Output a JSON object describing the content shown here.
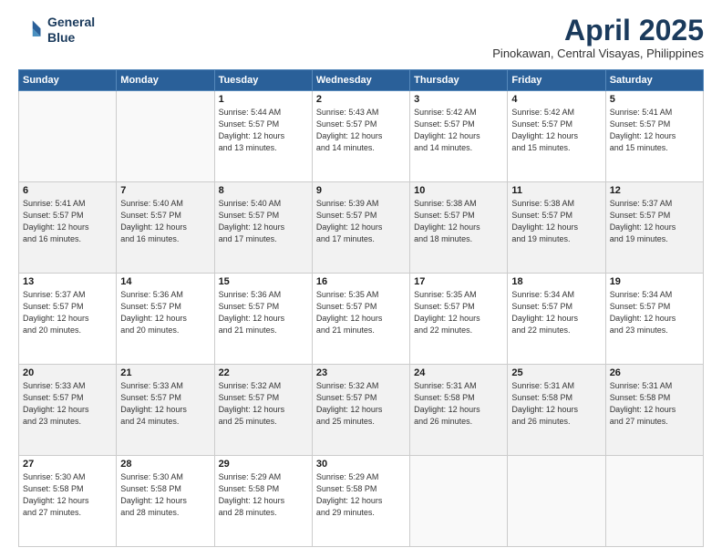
{
  "header": {
    "logo_line1": "General",
    "logo_line2": "Blue",
    "title": "April 2025",
    "subtitle": "Pinokawan, Central Visayas, Philippines"
  },
  "days_of_week": [
    "Sunday",
    "Monday",
    "Tuesday",
    "Wednesday",
    "Thursday",
    "Friday",
    "Saturday"
  ],
  "weeks": [
    [
      {
        "num": "",
        "info": ""
      },
      {
        "num": "",
        "info": ""
      },
      {
        "num": "1",
        "info": "Sunrise: 5:44 AM\nSunset: 5:57 PM\nDaylight: 12 hours\nand 13 minutes."
      },
      {
        "num": "2",
        "info": "Sunrise: 5:43 AM\nSunset: 5:57 PM\nDaylight: 12 hours\nand 14 minutes."
      },
      {
        "num": "3",
        "info": "Sunrise: 5:42 AM\nSunset: 5:57 PM\nDaylight: 12 hours\nand 14 minutes."
      },
      {
        "num": "4",
        "info": "Sunrise: 5:42 AM\nSunset: 5:57 PM\nDaylight: 12 hours\nand 15 minutes."
      },
      {
        "num": "5",
        "info": "Sunrise: 5:41 AM\nSunset: 5:57 PM\nDaylight: 12 hours\nand 15 minutes."
      }
    ],
    [
      {
        "num": "6",
        "info": "Sunrise: 5:41 AM\nSunset: 5:57 PM\nDaylight: 12 hours\nand 16 minutes."
      },
      {
        "num": "7",
        "info": "Sunrise: 5:40 AM\nSunset: 5:57 PM\nDaylight: 12 hours\nand 16 minutes."
      },
      {
        "num": "8",
        "info": "Sunrise: 5:40 AM\nSunset: 5:57 PM\nDaylight: 12 hours\nand 17 minutes."
      },
      {
        "num": "9",
        "info": "Sunrise: 5:39 AM\nSunset: 5:57 PM\nDaylight: 12 hours\nand 17 minutes."
      },
      {
        "num": "10",
        "info": "Sunrise: 5:38 AM\nSunset: 5:57 PM\nDaylight: 12 hours\nand 18 minutes."
      },
      {
        "num": "11",
        "info": "Sunrise: 5:38 AM\nSunset: 5:57 PM\nDaylight: 12 hours\nand 19 minutes."
      },
      {
        "num": "12",
        "info": "Sunrise: 5:37 AM\nSunset: 5:57 PM\nDaylight: 12 hours\nand 19 minutes."
      }
    ],
    [
      {
        "num": "13",
        "info": "Sunrise: 5:37 AM\nSunset: 5:57 PM\nDaylight: 12 hours\nand 20 minutes."
      },
      {
        "num": "14",
        "info": "Sunrise: 5:36 AM\nSunset: 5:57 PM\nDaylight: 12 hours\nand 20 minutes."
      },
      {
        "num": "15",
        "info": "Sunrise: 5:36 AM\nSunset: 5:57 PM\nDaylight: 12 hours\nand 21 minutes."
      },
      {
        "num": "16",
        "info": "Sunrise: 5:35 AM\nSunset: 5:57 PM\nDaylight: 12 hours\nand 21 minutes."
      },
      {
        "num": "17",
        "info": "Sunrise: 5:35 AM\nSunset: 5:57 PM\nDaylight: 12 hours\nand 22 minutes."
      },
      {
        "num": "18",
        "info": "Sunrise: 5:34 AM\nSunset: 5:57 PM\nDaylight: 12 hours\nand 22 minutes."
      },
      {
        "num": "19",
        "info": "Sunrise: 5:34 AM\nSunset: 5:57 PM\nDaylight: 12 hours\nand 23 minutes."
      }
    ],
    [
      {
        "num": "20",
        "info": "Sunrise: 5:33 AM\nSunset: 5:57 PM\nDaylight: 12 hours\nand 23 minutes."
      },
      {
        "num": "21",
        "info": "Sunrise: 5:33 AM\nSunset: 5:57 PM\nDaylight: 12 hours\nand 24 minutes."
      },
      {
        "num": "22",
        "info": "Sunrise: 5:32 AM\nSunset: 5:57 PM\nDaylight: 12 hours\nand 25 minutes."
      },
      {
        "num": "23",
        "info": "Sunrise: 5:32 AM\nSunset: 5:57 PM\nDaylight: 12 hours\nand 25 minutes."
      },
      {
        "num": "24",
        "info": "Sunrise: 5:31 AM\nSunset: 5:58 PM\nDaylight: 12 hours\nand 26 minutes."
      },
      {
        "num": "25",
        "info": "Sunrise: 5:31 AM\nSunset: 5:58 PM\nDaylight: 12 hours\nand 26 minutes."
      },
      {
        "num": "26",
        "info": "Sunrise: 5:31 AM\nSunset: 5:58 PM\nDaylight: 12 hours\nand 27 minutes."
      }
    ],
    [
      {
        "num": "27",
        "info": "Sunrise: 5:30 AM\nSunset: 5:58 PM\nDaylight: 12 hours\nand 27 minutes."
      },
      {
        "num": "28",
        "info": "Sunrise: 5:30 AM\nSunset: 5:58 PM\nDaylight: 12 hours\nand 28 minutes."
      },
      {
        "num": "29",
        "info": "Sunrise: 5:29 AM\nSunset: 5:58 PM\nDaylight: 12 hours\nand 28 minutes."
      },
      {
        "num": "30",
        "info": "Sunrise: 5:29 AM\nSunset: 5:58 PM\nDaylight: 12 hours\nand 29 minutes."
      },
      {
        "num": "",
        "info": ""
      },
      {
        "num": "",
        "info": ""
      },
      {
        "num": "",
        "info": ""
      }
    ]
  ]
}
